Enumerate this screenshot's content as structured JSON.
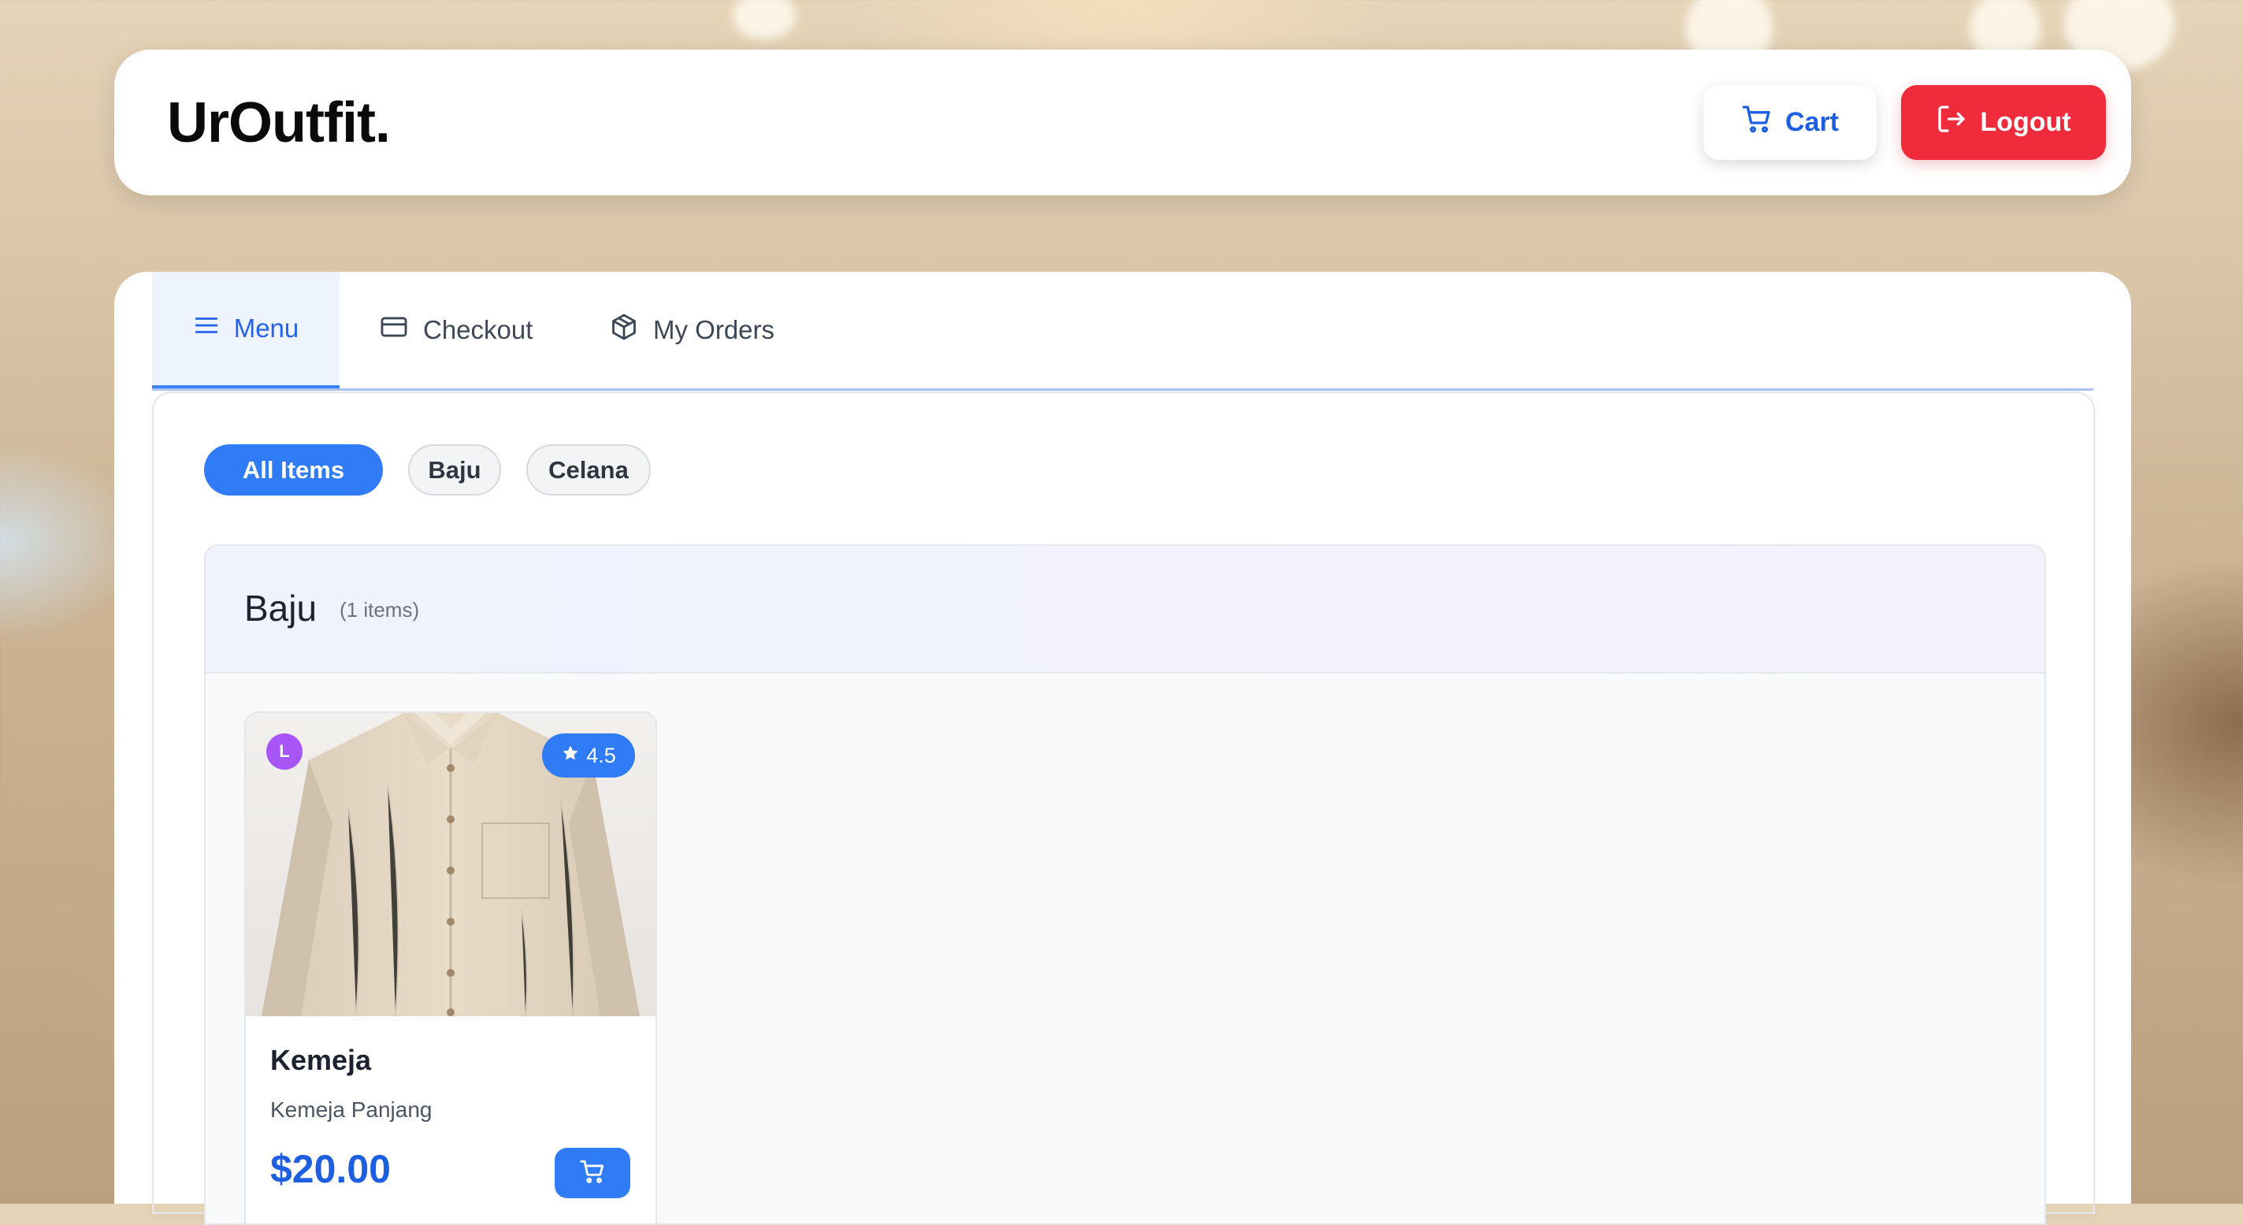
{
  "header": {
    "logo": "UrOutfit.",
    "cart_label": "Cart",
    "logout_label": "Logout"
  },
  "tabs": [
    {
      "label": "Menu",
      "icon": "menu-icon",
      "active": true
    },
    {
      "label": "Checkout",
      "icon": "credit-card-icon",
      "active": false
    },
    {
      "label": "My Orders",
      "icon": "package-icon",
      "active": false
    }
  ],
  "filters": [
    {
      "label": "All Items",
      "active": true
    },
    {
      "label": "Baju",
      "active": false
    },
    {
      "label": "Celana",
      "active": false
    }
  ],
  "section": {
    "title": "Baju",
    "count": "(1 items)"
  },
  "products": [
    {
      "size": "L",
      "rating": "4.5",
      "name": "Kemeja",
      "description": "Kemeja Panjang",
      "price": "$20.00",
      "image": "beige-linen-shirt"
    }
  ],
  "colors": {
    "accent": "#2f7cf6",
    "logout": "#f02b3b",
    "size_badge": "#a855f7"
  }
}
